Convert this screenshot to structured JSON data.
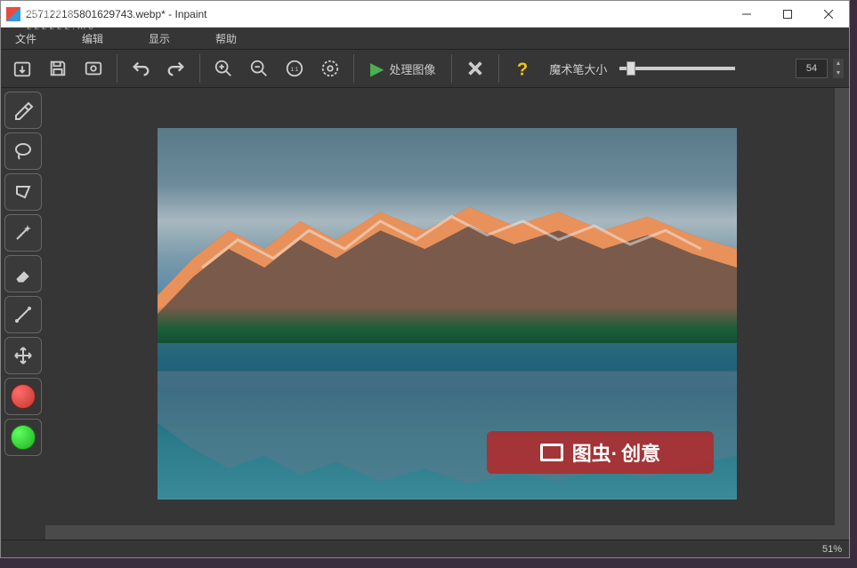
{
  "watermark": {
    "line1": "峰哥博客",
    "line2": "zzzzzz.me"
  },
  "titlebar": {
    "title": "2571221858​01629743.webp* - Inpaint"
  },
  "menubar": {
    "file": "文件",
    "edit": "编辑",
    "view": "显示",
    "help": "帮助"
  },
  "toolbar": {
    "process_label": "处理图像",
    "brush_label": "魔术笔大小",
    "brush_value": "54"
  },
  "overlay": {
    "text1": "图虫·",
    "text2": "创意"
  },
  "statusbar": {
    "zoom": "51%"
  }
}
